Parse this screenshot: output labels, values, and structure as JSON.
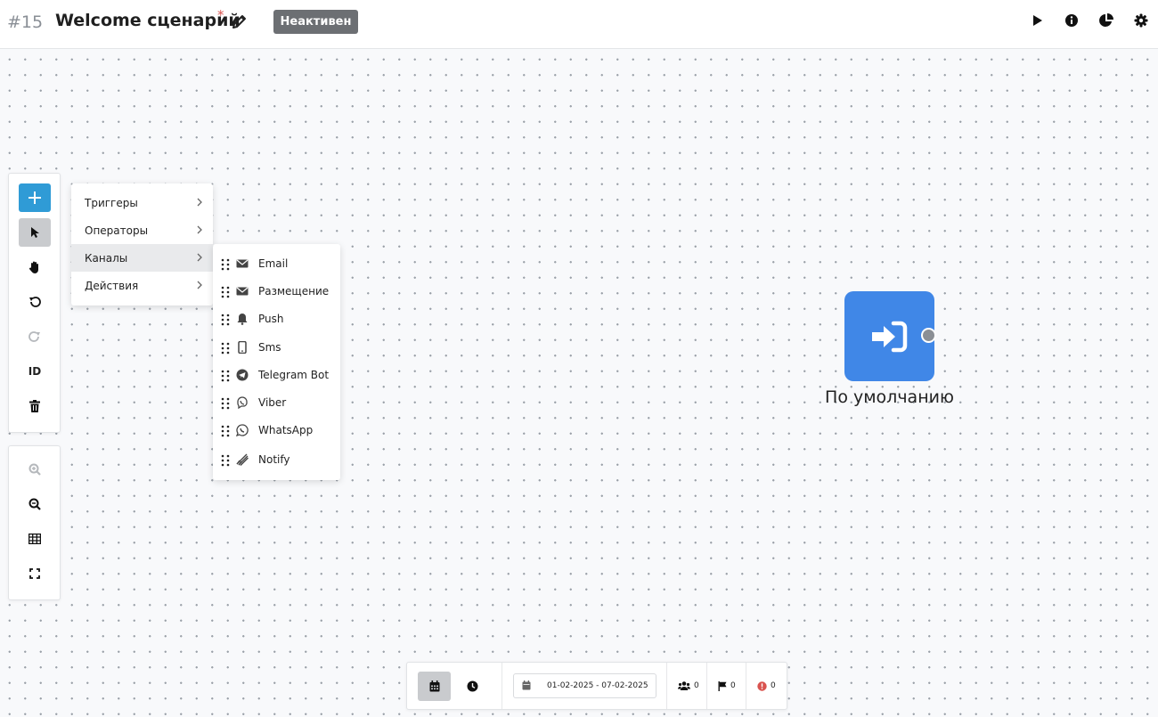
{
  "header": {
    "scenario_id": "#15",
    "title": "Welcome сценарий",
    "required_mark": "*",
    "status": "Неактивен",
    "actions": [
      "play-icon",
      "info-icon",
      "pie-chart-icon",
      "gear-icon"
    ]
  },
  "toolbar_main": {
    "buttons": [
      "add",
      "select-pointer",
      "hand-pan",
      "undo",
      "redo",
      "id",
      "delete"
    ],
    "id_label": "ID"
  },
  "toolbar_view": {
    "buttons": [
      "zoom-in",
      "zoom-out",
      "grid",
      "fullscreen"
    ]
  },
  "menu": {
    "items": [
      {
        "label": "Триггеры"
      },
      {
        "label": "Операторы"
      },
      {
        "label": "Каналы",
        "selected": true
      },
      {
        "label": "Действия"
      }
    ]
  },
  "submenu": {
    "items": [
      {
        "label": "Email",
        "icon": "envelope-icon"
      },
      {
        "label": "Размещение",
        "icon": "envelope-icon"
      },
      {
        "label": "Push",
        "icon": "bell-icon"
      },
      {
        "label": "Sms",
        "icon": "mobile-icon"
      },
      {
        "label": "Telegram Bot",
        "icon": "telegram-icon"
      },
      {
        "label": "Viber",
        "icon": "viber-icon"
      },
      {
        "label": "WhatsApp",
        "icon": "whatsapp-icon"
      },
      {
        "label": "Notify",
        "icon": "notify-icon"
      }
    ]
  },
  "node": {
    "label": "По умолчанию",
    "icon": "sign-in-icon",
    "color": "#4087e7"
  },
  "bottom_bar": {
    "date_range": "01-02-2025 - 07-02-2025",
    "users_count": "0",
    "flags_count": "0",
    "errors_count": "0"
  },
  "colors": {
    "accent": "#2f9bd6",
    "status_badge": "#6c6f73",
    "error": "#d9534f"
  }
}
